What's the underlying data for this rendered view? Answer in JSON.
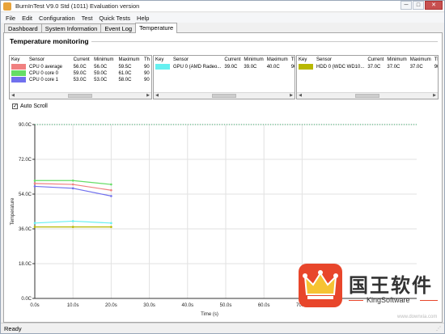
{
  "window": {
    "title": "BurnInTest V9.0 Std (1011) Evaluation version",
    "controls": [
      "─",
      "□",
      "✕"
    ]
  },
  "menu": [
    "File",
    "Edit",
    "Configuration",
    "Test",
    "Quick Tests",
    "Help"
  ],
  "tabs": [
    {
      "label": "Dashboard",
      "active": false
    },
    {
      "label": "System Information",
      "active": false
    },
    {
      "label": "Event Log",
      "active": false
    },
    {
      "label": "Temperature",
      "active": true
    }
  ],
  "section_title": "Temperature monitoring",
  "grid_headers": [
    "Key",
    "Sensor",
    "Current",
    "Minimum",
    "Maximum",
    "Th"
  ],
  "grids": [
    {
      "rows": [
        {
          "color": "#f08080",
          "sensor": "CPU 0 average",
          "current": "56.0C",
          "minimum": "56.0C",
          "maximum": "59.5C",
          "th": "90"
        },
        {
          "color": "#66dd66",
          "sensor": "CPU 0 core 0",
          "current": "59.0C",
          "minimum": "59.0C",
          "maximum": "61.0C",
          "th": "90"
        },
        {
          "color": "#7070ee",
          "sensor": "CPU 0 core 1",
          "current": "53.0C",
          "minimum": "53.0C",
          "maximum": "58.0C",
          "th": "90"
        }
      ]
    },
    {
      "rows": [
        {
          "color": "#66f0f0",
          "sensor": "GPU 0 (AMD Radeo...",
          "current": "39.0C",
          "minimum": "39.0C",
          "maximum": "40.0C",
          "th": "90"
        }
      ]
    },
    {
      "rows": [
        {
          "color": "#b8b800",
          "sensor": "HDD 0 (WDC WD10...",
          "current": "37.0C",
          "minimum": "37.0C",
          "maximum": "37.0C",
          "th": "90"
        }
      ]
    }
  ],
  "auto_scroll_label": "Auto Scroll",
  "status": "Ready",
  "watermark": {
    "cn": "国王软件",
    "en": "KingSoftware",
    "small": "www.downxia.com"
  },
  "chart_data": {
    "type": "line",
    "xlabel": "Time (s)",
    "ylabel": "Temperature",
    "x_ticks": [
      "0.0s",
      "10.0s",
      "20.0s",
      "30.0s",
      "40.0s",
      "50.0s",
      "60.0s",
      "70.0s"
    ],
    "y_ticks": [
      "0.0C",
      "18.0C",
      "36.0C",
      "54.0C",
      "72.0C",
      "90.0C"
    ],
    "xlim": [
      0,
      100
    ],
    "ylim": [
      0,
      90
    ],
    "threshold": 90,
    "x": [
      0,
      10,
      20
    ],
    "series": [
      {
        "name": "CPU 0 average",
        "color": "#f08080",
        "values": [
          59.5,
          59.0,
          56.0
        ]
      },
      {
        "name": "CPU 0 core 0",
        "color": "#66dd66",
        "values": [
          61.0,
          61.0,
          59.0
        ]
      },
      {
        "name": "CPU 0 core 1",
        "color": "#7070ee",
        "values": [
          58.0,
          57.0,
          53.0
        ]
      },
      {
        "name": "GPU 0 (AMD Radeo...",
        "color": "#66f0f0",
        "values": [
          39.0,
          40.0,
          39.0
        ]
      },
      {
        "name": "HDD 0 (WDC WD10...",
        "color": "#b8b800",
        "values": [
          37.0,
          37.0,
          37.0
        ]
      }
    ]
  }
}
